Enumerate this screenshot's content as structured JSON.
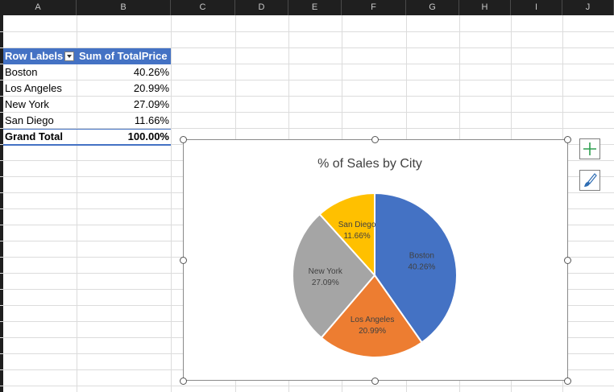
{
  "columns": [
    "A",
    "B",
    "C",
    "D",
    "E",
    "F",
    "G",
    "H",
    "I",
    "J"
  ],
  "pivot": {
    "header_row_labels": "Row Labels",
    "header_value": "Sum of TotalPrice",
    "rows": [
      {
        "label": "Boston",
        "value": "40.26%"
      },
      {
        "label": "Los Angeles",
        "value": "20.99%"
      },
      {
        "label": "New York",
        "value": "27.09%"
      },
      {
        "label": "San Diego",
        "value": "11.66%"
      }
    ],
    "total_label": "Grand Total",
    "total_value": "100.00%"
  },
  "chart_data": {
    "type": "pie",
    "title": "% of Sales by City",
    "categories": [
      "Boston",
      "Los Angeles",
      "New York",
      "San Diego"
    ],
    "values": [
      40.26,
      20.99,
      27.09,
      11.66
    ],
    "labels": [
      "40.26%",
      "20.99%",
      "27.09%",
      "11.66%"
    ],
    "colors": [
      "#4472c4",
      "#ed7d31",
      "#a5a5a5",
      "#ffc000"
    ],
    "legend": "none"
  },
  "colors": {
    "pivot_header": "#4472c4",
    "column_header_bg": "#1f1f1f",
    "chart_elements_plus": "#2e9e4f"
  },
  "icons": {
    "chart_elements": "plus-icon",
    "chart_styles": "paintbrush-icon"
  }
}
